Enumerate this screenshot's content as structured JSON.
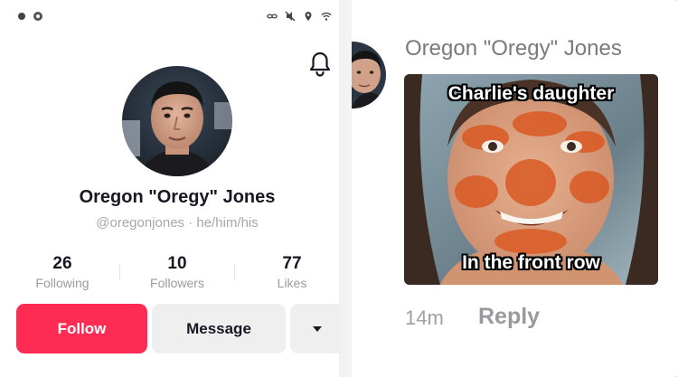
{
  "profile": {
    "name": "Oregon \"Oregy\" Jones",
    "handle": "@oregonjones · he/him/his",
    "stats": [
      {
        "value": "26",
        "label": "Following"
      },
      {
        "value": "10",
        "label": "Followers"
      },
      {
        "value": "77",
        "label": "Likes"
      }
    ],
    "buttons": {
      "follow": "Follow",
      "message": "Message",
      "more": "▾"
    },
    "icons": {
      "notification": "bell-icon",
      "more": "caret-down-icon"
    }
  },
  "comment": {
    "author": "Oregon \"Oregy\" Jones",
    "meme_top_text": "Charlie's daughter",
    "meme_bottom_text": "In the front row",
    "time": "14m",
    "reply_label": "Reply"
  },
  "colors": {
    "follow_button": "#fe2c55",
    "secondary_button": "#efefef",
    "muted_text": "#a7a7ab"
  }
}
